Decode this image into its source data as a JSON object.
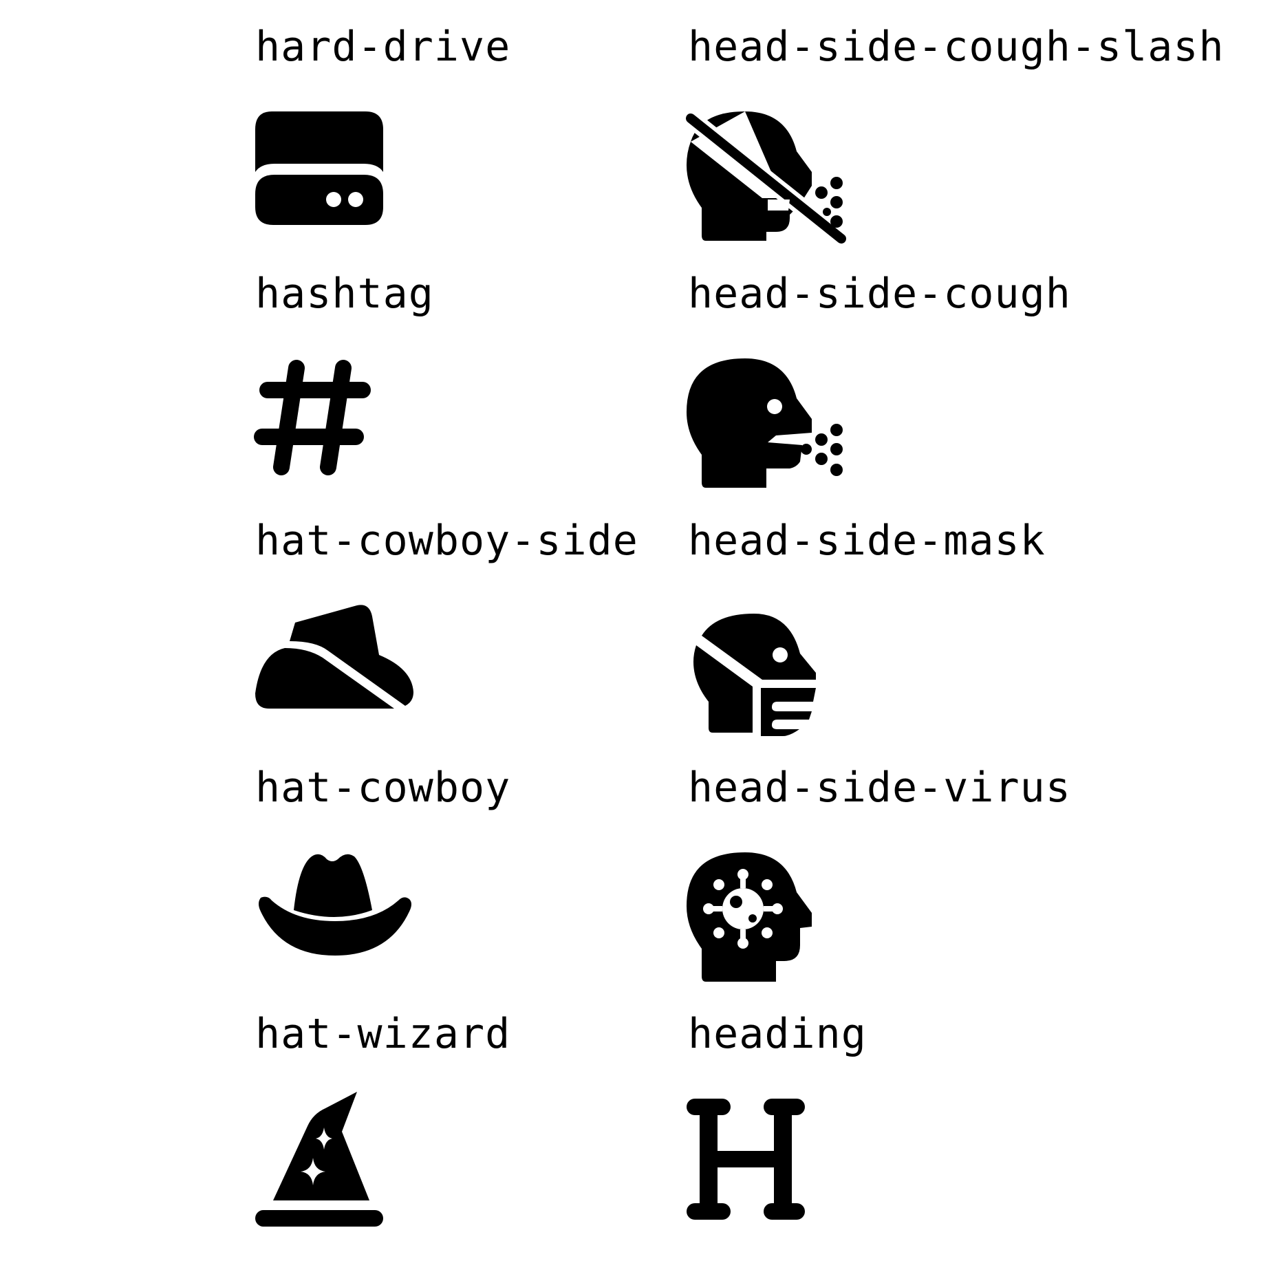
{
  "background_color": "#ffffff",
  "foreground_color": "#000000",
  "icons": [
    {
      "label": "hard-drive",
      "icon": "hard-drive-icon"
    },
    {
      "label": "head-side-cough-slash",
      "icon": "head-side-cough-slash-icon"
    },
    {
      "label": "hashtag",
      "icon": "hashtag-icon"
    },
    {
      "label": "head-side-cough",
      "icon": "head-side-cough-icon"
    },
    {
      "label": "hat-cowboy-side",
      "icon": "hat-cowboy-side-icon"
    },
    {
      "label": "head-side-mask",
      "icon": "head-side-mask-icon"
    },
    {
      "label": "hat-cowboy",
      "icon": "hat-cowboy-icon"
    },
    {
      "label": "head-side-virus",
      "icon": "head-side-virus-icon"
    },
    {
      "label": "hat-wizard",
      "icon": "hat-wizard-icon"
    },
    {
      "label": "heading",
      "icon": "heading-icon"
    }
  ]
}
